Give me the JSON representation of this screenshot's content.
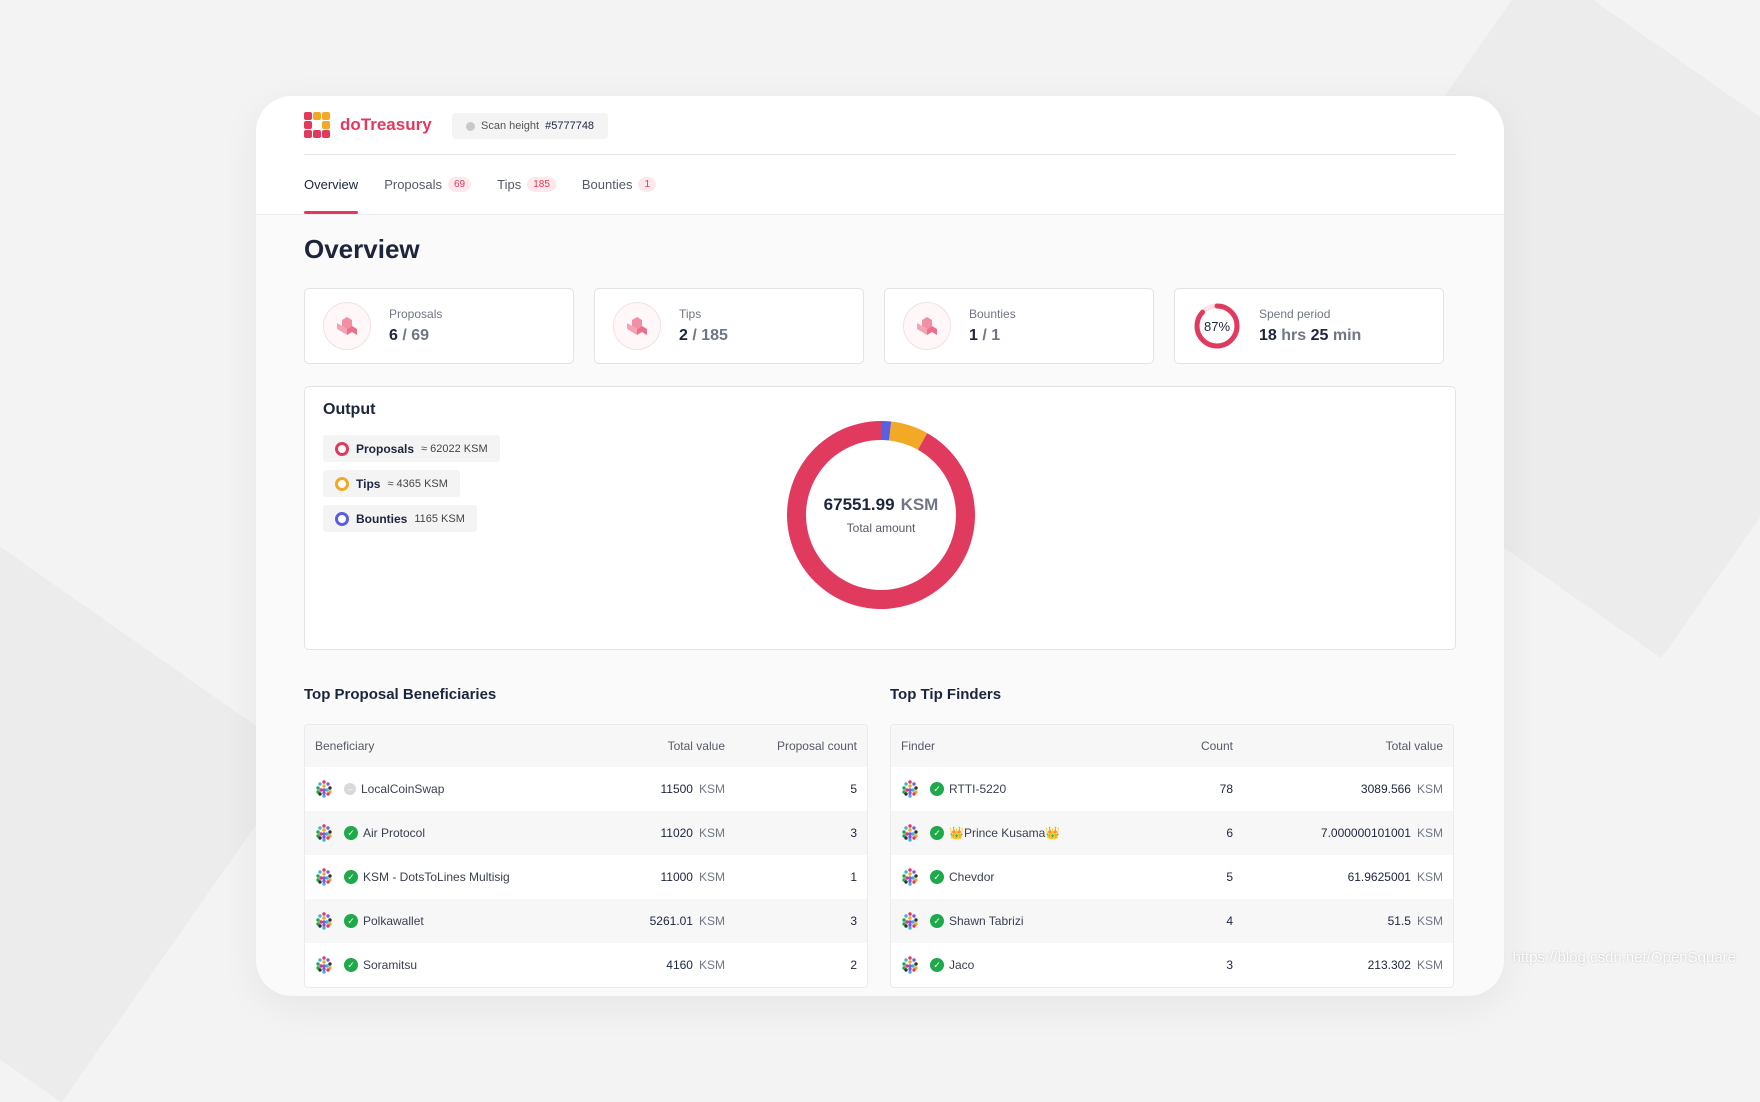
{
  "app": {
    "name": "doTreasury",
    "brand_color": "#e03a5f"
  },
  "scan": {
    "label": "Scan height",
    "value": "#5777748"
  },
  "tabs": [
    {
      "label": "Overview",
      "badge": ""
    },
    {
      "label": "Proposals",
      "badge": "69"
    },
    {
      "label": "Tips",
      "badge": "185"
    },
    {
      "label": "Bounties",
      "badge": "1"
    }
  ],
  "page_title": "Overview",
  "stats": [
    {
      "label": "Proposals",
      "value": "6",
      "total": "/ 69"
    },
    {
      "label": "Tips",
      "value": "2",
      "total": "/ 185"
    },
    {
      "label": "Bounties",
      "value": "1",
      "total": "/ 1"
    }
  ],
  "spend_period": {
    "label": "Spend period",
    "percent_text": "87%",
    "progress": 0.87,
    "hrs": "18",
    "hrs_unit": "hrs",
    "min": "25",
    "min_unit": "min"
  },
  "output": {
    "title": "Output",
    "legend": [
      {
        "name": "Proposals",
        "value": "≈ 62022 KSM",
        "color": "#e03a5f"
      },
      {
        "name": "Tips",
        "value": "≈ 4365 KSM",
        "color": "#f2a925"
      },
      {
        "name": "Bounties",
        "value": "1165 KSM",
        "color": "#5a5fe0"
      }
    ],
    "total_amount": "67551.99",
    "total_unit": "KSM",
    "total_label": "Total amount"
  },
  "chart_data": {
    "type": "pie",
    "categories": [
      "Proposals",
      "Tips",
      "Bounties"
    ],
    "values": [
      62022,
      4365,
      1165
    ],
    "colors": [
      "#e03a5f",
      "#f2a925",
      "#5a5fe0"
    ],
    "title": "Output"
  },
  "beneficiaries": {
    "title": "Top Proposal Beneficiaries",
    "columns": [
      "Beneficiary",
      "Total value",
      "Proposal count"
    ],
    "rows": [
      {
        "name": "LocalCoinSwap",
        "verified": false,
        "value": "11500",
        "unit": "KSM",
        "count": "5"
      },
      {
        "name": "Air Protocol",
        "verified": true,
        "value": "11020",
        "unit": "KSM",
        "count": "3"
      },
      {
        "name": "KSM - DotsToLines Multisig",
        "verified": true,
        "value": "11000",
        "unit": "KSM",
        "count": "1"
      },
      {
        "name": "Polkawallet",
        "verified": true,
        "value": "5261.01",
        "unit": "KSM",
        "count": "3"
      },
      {
        "name": "Soramitsu",
        "verified": true,
        "value": "4160",
        "unit": "KSM",
        "count": "2"
      }
    ]
  },
  "finders": {
    "title": "Top Tip Finders",
    "columns": [
      "Finder",
      "Count",
      "Total value"
    ],
    "rows": [
      {
        "name": "RTTI-5220",
        "verified": true,
        "count": "78",
        "value": "3089.566",
        "unit": "KSM"
      },
      {
        "name": "👑Prince Kusama👑",
        "verified": true,
        "count": "6",
        "value": "7.000000101001",
        "unit": "KSM"
      },
      {
        "name": "Chevdor",
        "verified": true,
        "count": "5",
        "value": "61.9625001",
        "unit": "KSM"
      },
      {
        "name": "Shawn Tabrizi",
        "verified": true,
        "count": "4",
        "value": "51.5",
        "unit": "KSM"
      },
      {
        "name": "Jaco",
        "verified": true,
        "count": "3",
        "value": "213.302",
        "unit": "KSM"
      }
    ]
  },
  "watermark": "https://blog.csdn.net/OpenSquare"
}
